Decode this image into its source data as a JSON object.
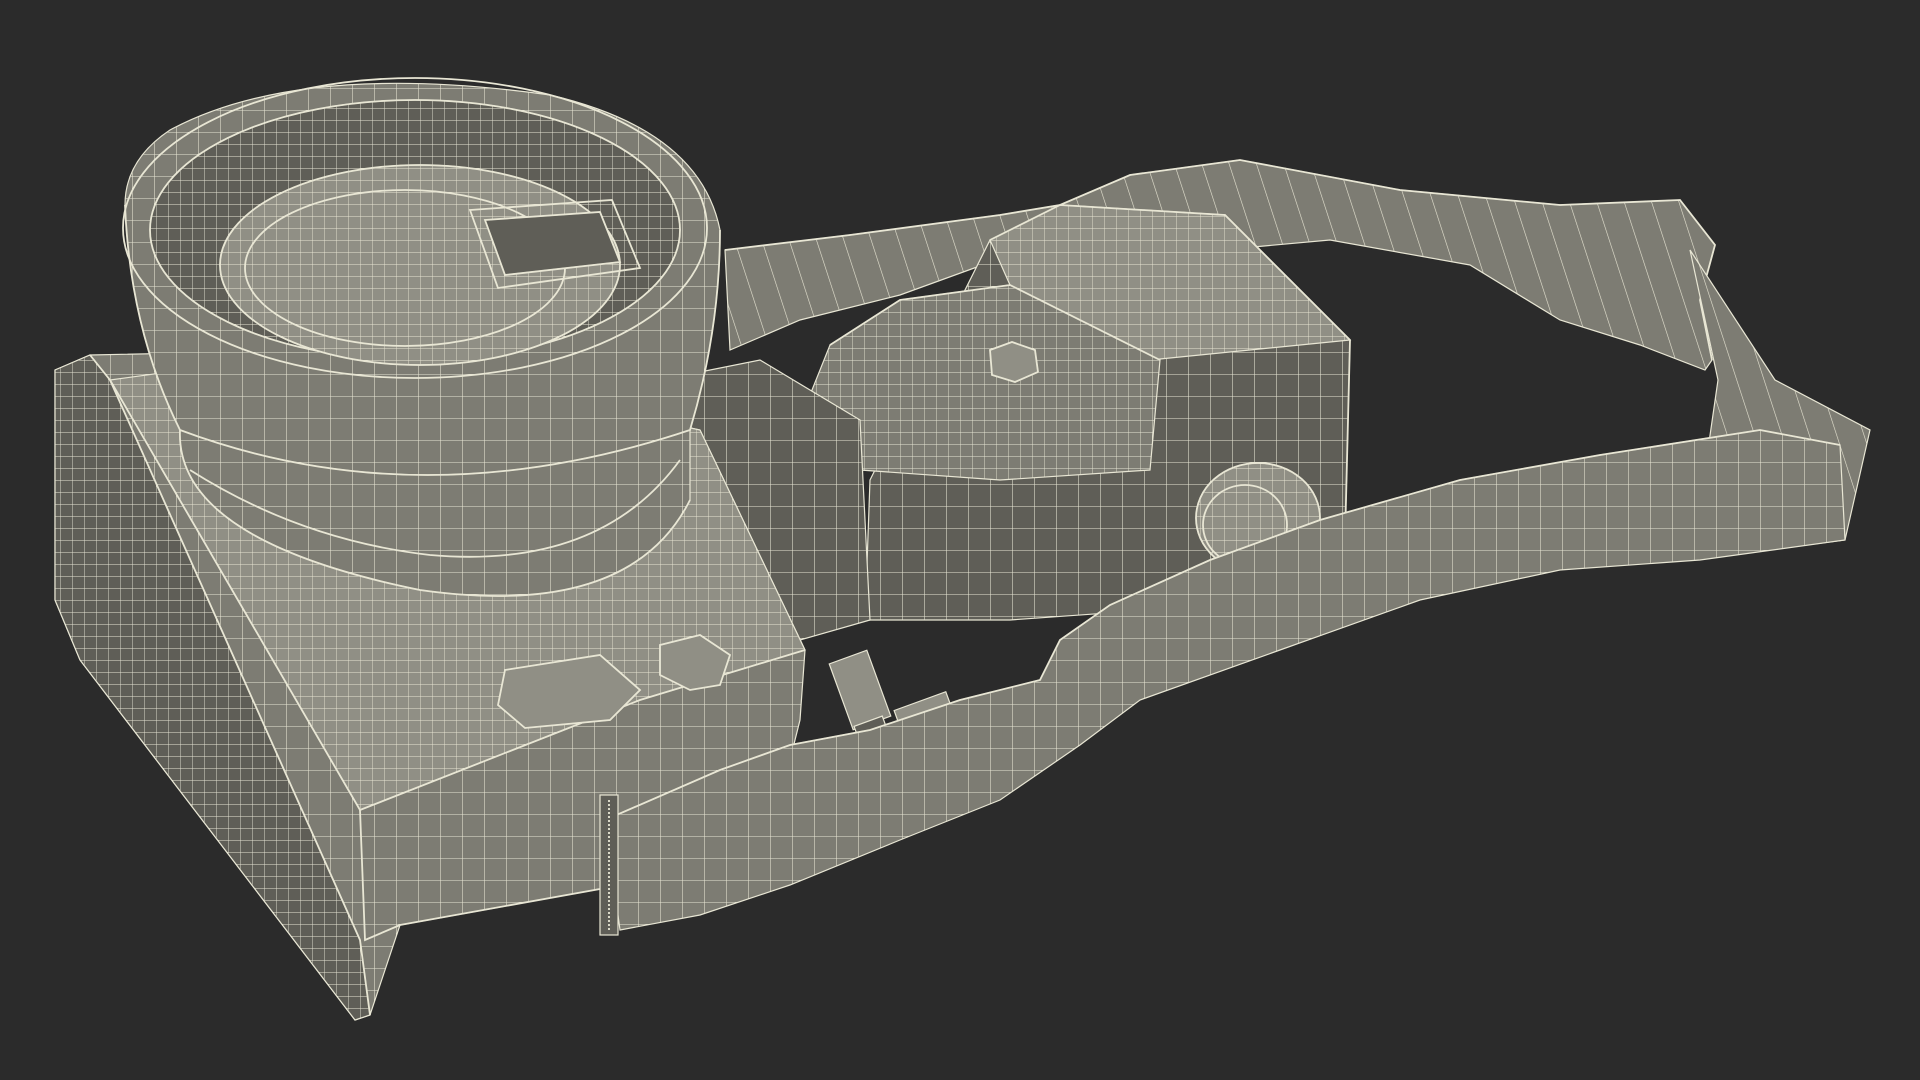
{
  "viewport": {
    "background_color": "#2b2b2b"
  },
  "subject": {
    "icon": "wireframe-camera-icon",
    "surface_color": "#7d7c73",
    "surface_shadow_color": "#5f5e57",
    "surface_highlight_color": "#908f85",
    "wire_color": "#e8e6d4",
    "parts": [
      {
        "icon": "camera-body-icon"
      },
      {
        "icon": "lens-barrel-icon"
      },
      {
        "icon": "lens-hood-icon"
      },
      {
        "icon": "lens-cap-icon"
      },
      {
        "icon": "viewfinder-icon"
      },
      {
        "icon": "mode-dial-icon"
      },
      {
        "icon": "hot-shoe-icon"
      },
      {
        "icon": "shutter-button-icon"
      },
      {
        "icon": "shoulder-strap-icon"
      }
    ]
  }
}
